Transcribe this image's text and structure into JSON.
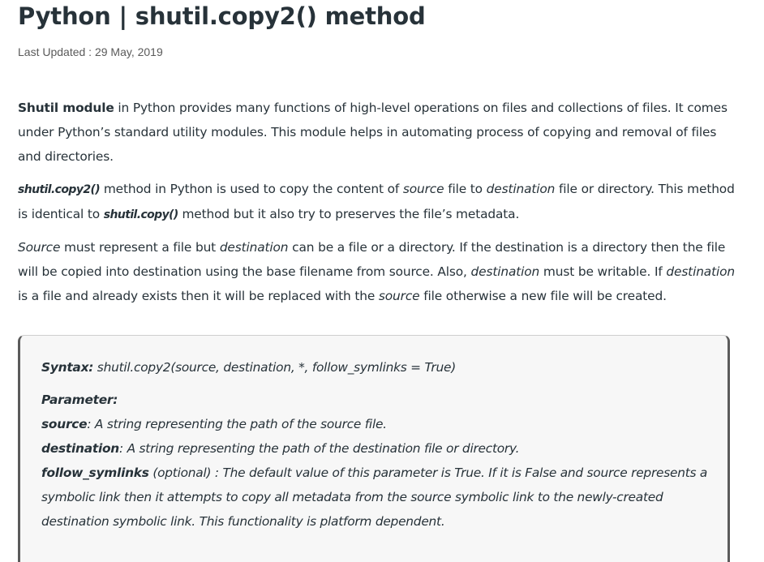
{
  "article": {
    "title": "Python | shutil.copy2() method",
    "last_updated": "Last Updated : 29 May, 2019"
  },
  "paragraph1": {
    "bold": "Shutil module",
    "text": " in Python provides many functions of high-level operations on files and collections of files. It comes under Python’s standard utility modules. This module helps in automating process of copying and removal of files and directories."
  },
  "paragraph2": {
    "code1": "shutil.copy2()",
    "t1": " method in Python is used to copy the content of ",
    "em1": "source",
    "t2": " file to ",
    "em2": "destination",
    "t3": " file or directory. This method is identical to ",
    "code2": "shutil.copy()",
    "t4": " method but it also try to preserves the file’s metadata."
  },
  "paragraph3": {
    "em1": "Source",
    "t1": " must represent a file but ",
    "em2": "destination",
    "t2": " can be a file or a directory. If the destination is a directory then the file will be copied into destination using the base filename from source. Also, ",
    "em3": "destination",
    "t3": " must be writable. If ",
    "em4": "destination",
    "t4": " is a file and already exists then it will be replaced with the ",
    "em5": "source",
    "t5": " file otherwise a new file will be created."
  },
  "syntax_box": {
    "syntax_label": "Syntax:",
    "syntax_text": " shutil.copy2(source, destination, *, follow_symlinks = True)",
    "parameter_label": "Parameter:",
    "params": [
      {
        "name": "source",
        "desc": ": A string representing the path of the source file."
      },
      {
        "name": "destination",
        "desc": ": A string representing the path of the destination file or directory."
      },
      {
        "name": "follow_symlinks",
        "desc": " (optional) : The default value of this parameter is True. If it is False and source represents a symbolic link then it attempts to copy all metadata from the source symbolic link to the newly-created destination symbolic link. This functionality is platform dependent."
      }
    ]
  }
}
